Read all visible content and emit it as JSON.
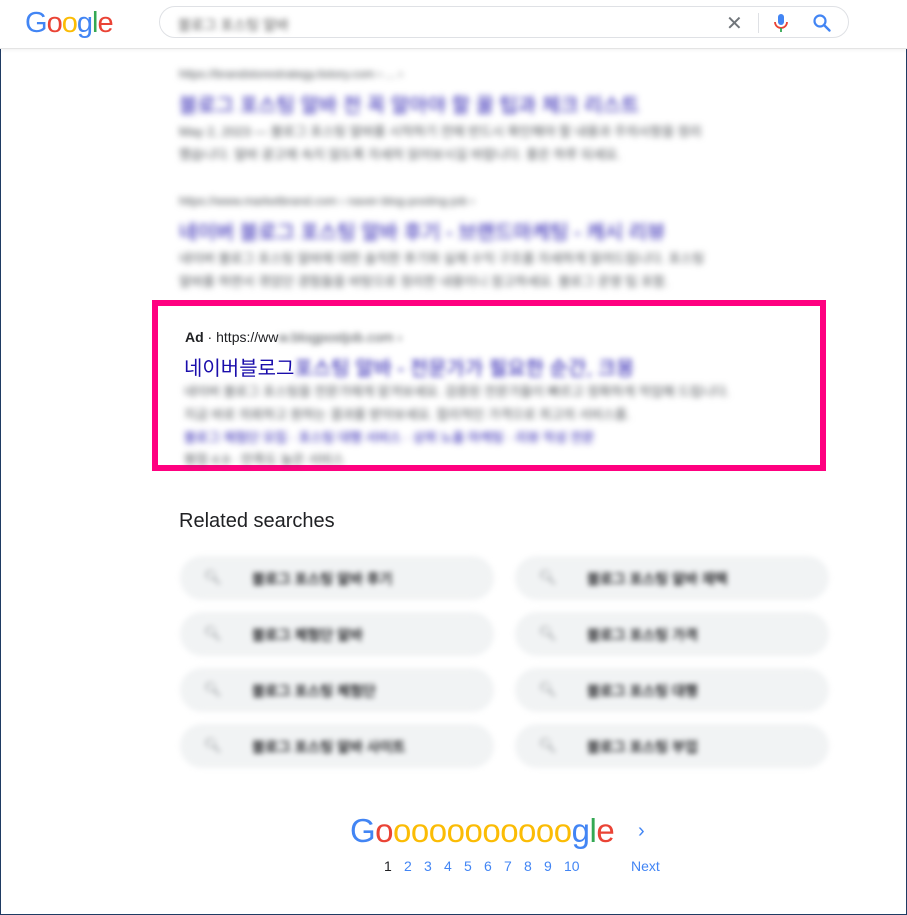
{
  "header": {
    "logo": [
      "G",
      "o",
      "o",
      "g",
      "l",
      "e"
    ],
    "search_value": "블로그 포스팅 알바",
    "icons": {
      "clear": "close-icon",
      "voice": "microphone-icon",
      "search": "search-icon"
    }
  },
  "results": [
    {
      "url": "https://brandstorestrategy.tistory.com › ... ›",
      "title": "블로그 포스팅 알바 전 꼭 알아야 할 꿀 팁과 체크 리스트",
      "snippet": [
        "May 2, 2023 — 블로그 포스팅 알바를 시작하기 전에 반드시 확인해야 할 내용과 주의사항을 정리",
        "했습니다. 알바 광고에 속지 않도록 자세히 읽어보시길 바랍니다. 좋은 하루 되세요."
      ]
    },
    {
      "url": "https://www.marketbrand.com › naver-blog-posting-job ›",
      "title": "네이버 블로그 포스팅 알바 후기 - 브랜드마케팅 - 캐시 리뷰",
      "snippet": [
        "네이버 블로그 포스팅 알바에 대한 솔직한 후기와 실제 수익 구조를 자세하게 알려드립니다. 포스팅",
        "알바를 하면서 겪었던 경험들을 바탕으로 정리한 내용이니 참고하세요. 블로그 운영 팁 포함."
      ]
    }
  ],
  "ad": {
    "label": "Ad",
    "separator": " · ",
    "url_visible": "https://ww",
    "url_blurred": "w.blogpostjob.com ›",
    "title_visible": "네이버블로그",
    "title_blurred": " 포스팅 알바 - 전문가가 필요한 순간, 크몽",
    "lines": [
      "네이버 블로그 포스팅을 전문가에게 맡겨보세요. 검증된 전문가들이 빠르고 정확하게 작업해 드립니다.",
      "지금 바로 의뢰하고 원하는 결과를 받아보세요. 합리적인 가격으로 최고의 서비스를.",
      "블로그 체험단 모집 · 포스팅 대행 서비스 · 상위 노출 마케팅 · 리뷰 작성 전문",
      "평점 4.9 · 만족도 높은 서비스"
    ]
  },
  "related": {
    "title": "Related searches",
    "chip_icon": "search-icon",
    "items": [
      "블로그 포스팅 알바 후기",
      "블로그 포스팅 알바 재택",
      "블로그 체험단 알바",
      "블로그 포스팅 가격",
      "블로그 포스팅 체험단",
      "블로그 포스팅 대행",
      "블로그 포스팅 알바 사이트",
      "블로그 포스팅 부업"
    ]
  },
  "pagination": {
    "logo": [
      "G",
      "o",
      "o",
      "o",
      "o",
      "o",
      "o",
      "o",
      "o",
      "o",
      "o",
      "o",
      "g",
      "l",
      "e"
    ],
    "current": "1",
    "pages": [
      "1",
      "2",
      "3",
      "4",
      "5",
      "6",
      "7",
      "8",
      "9",
      "10"
    ],
    "next_label": "Next",
    "next_icon": "chevron-right-icon"
  }
}
